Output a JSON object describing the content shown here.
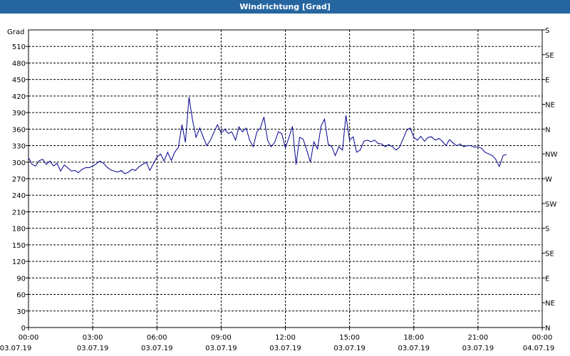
{
  "window": {
    "title": "Windrichtung [Grad]"
  },
  "chart_data": {
    "type": "line",
    "ylabel": "Grad",
    "ylim": [
      0,
      540
    ],
    "ytick_values": [
      0,
      30,
      60,
      90,
      120,
      150,
      180,
      210,
      240,
      270,
      300,
      330,
      360,
      390,
      420,
      450,
      480,
      510
    ],
    "y2_ticks": [
      {
        "value": 0,
        "label": "N"
      },
      {
        "value": 45,
        "label": "NE"
      },
      {
        "value": 90,
        "label": "E"
      },
      {
        "value": 135,
        "label": "SE"
      },
      {
        "value": 180,
        "label": "S"
      },
      {
        "value": 225,
        "label": "SW"
      },
      {
        "value": 270,
        "label": "W"
      },
      {
        "value": 315,
        "label": "NW"
      },
      {
        "value": 360,
        "label": "N"
      },
      {
        "value": 405,
        "label": "NE"
      },
      {
        "value": 450,
        "label": "E"
      },
      {
        "value": 495,
        "label": "SE"
      },
      {
        "value": 540,
        "label": "S"
      }
    ],
    "xlim": [
      0,
      24
    ],
    "x_ticks": [
      {
        "value": 0,
        "time": "00:00",
        "date": "03.07.19"
      },
      {
        "value": 3,
        "time": "03:00",
        "date": "03.07.19"
      },
      {
        "value": 6,
        "time": "06:00",
        "date": "03.07.19"
      },
      {
        "value": 9,
        "time": "09:00",
        "date": "03.07.19"
      },
      {
        "value": 12,
        "time": "12:00",
        "date": "03.07.19"
      },
      {
        "value": 15,
        "time": "15:00",
        "date": "03.07.19"
      },
      {
        "value": 18,
        "time": "18:00",
        "date": "03.07.19"
      },
      {
        "value": 21,
        "time": "21:00",
        "date": "03.07.19"
      },
      {
        "value": 24,
        "time": "00:00",
        "date": "04.07.19"
      }
    ],
    "grid": true,
    "line_color": "#00008b",
    "x": [
      0,
      0.17,
      0.33,
      0.5,
      0.67,
      0.83,
      1,
      1.17,
      1.33,
      1.5,
      1.67,
      1.83,
      2,
      2.17,
      2.33,
      2.5,
      2.67,
      2.83,
      3,
      3.17,
      3.33,
      3.5,
      3.67,
      3.83,
      4,
      4.17,
      4.33,
      4.5,
      4.67,
      4.83,
      5,
      5.17,
      5.33,
      5.5,
      5.67,
      5.83,
      6,
      6.17,
      6.33,
      6.5,
      6.67,
      6.83,
      7,
      7.17,
      7.33,
      7.5,
      7.67,
      7.83,
      8,
      8.17,
      8.33,
      8.5,
      8.67,
      8.83,
      9,
      9.17,
      9.33,
      9.5,
      9.67,
      9.83,
      10,
      10.17,
      10.33,
      10.5,
      10.67,
      10.83,
      11,
      11.17,
      11.33,
      11.5,
      11.67,
      11.83,
      12,
      12.17,
      12.33,
      12.5,
      12.67,
      12.83,
      13,
      13.17,
      13.33,
      13.5,
      13.67,
      13.83,
      14,
      14.17,
      14.33,
      14.5,
      14.67,
      14.83,
      15,
      15.17,
      15.33,
      15.5,
      15.67,
      15.83,
      16,
      16.17,
      16.33,
      16.5,
      16.67,
      16.83,
      17,
      17.17,
      17.33,
      17.5,
      17.67,
      17.83,
      18,
      18.17,
      18.33,
      18.5,
      18.67,
      18.83,
      19,
      19.17,
      19.33,
      19.5,
      19.67,
      19.83,
      20,
      20.17,
      20.33,
      20.5,
      20.67,
      20.83,
      21,
      21.17,
      21.33,
      21.5,
      21.67,
      21.83,
      22,
      22.17,
      22.33,
      22.5,
      22.67,
      22.83,
      23,
      23.17,
      23.33,
      23.5,
      23.67,
      23.83
    ],
    "values": [
      308,
      296,
      293,
      303,
      305,
      296,
      302,
      293,
      298,
      284,
      295,
      290,
      284,
      285,
      281,
      287,
      290,
      290,
      293,
      297,
      302,
      298,
      291,
      286,
      284,
      282,
      285,
      279,
      282,
      287,
      285,
      292,
      296,
      300,
      285,
      297,
      309,
      315,
      302,
      318,
      303,
      318,
      327,
      368,
      336,
      418,
      375,
      345,
      362,
      345,
      330,
      340,
      355,
      368,
      353,
      360,
      352,
      355,
      340,
      364,
      355,
      362,
      340,
      328,
      355,
      362,
      382,
      340,
      328,
      336,
      355,
      352,
      326,
      345,
      365,
      296,
      345,
      342,
      322,
      300,
      337,
      324,
      366,
      378,
      333,
      328,
      312,
      328,
      322,
      385,
      340,
      346,
      318,
      322,
      338,
      340,
      337,
      340,
      334,
      333,
      328,
      332,
      328,
      322,
      327,
      342,
      358,
      362,
      345,
      340,
      347,
      338,
      345,
      346,
      340,
      343,
      338,
      330,
      341,
      335,
      330,
      333,
      328,
      330,
      330,
      327,
      328,
      325,
      318,
      315,
      312,
      305,
      292,
      312,
      314
    ]
  }
}
